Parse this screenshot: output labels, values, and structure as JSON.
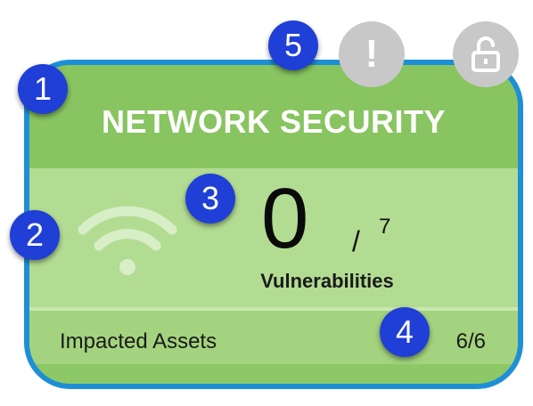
{
  "card": {
    "title": "NETWORK SECURITY",
    "icon": "wifi-icon",
    "vulnerabilities": {
      "count": "0",
      "separator": "/",
      "total": "7",
      "label": "Vulnerabilities"
    },
    "impacted_assets": {
      "label": "Impacted Assets",
      "value": "6/6"
    }
  },
  "status_buttons": {
    "alert": {
      "icon": "exclamation-icon",
      "glyph": "!"
    },
    "lock": {
      "icon": "unlock-icon"
    }
  },
  "callouts": [
    "1",
    "2",
    "3",
    "4",
    "5"
  ],
  "colors": {
    "card_border": "#1e8fd6",
    "card_header": "#88c460",
    "card_body": "#b2dc92",
    "card_footer": "#a3d37e",
    "callout": "#1f3fd6",
    "status_button": "#c8c8c8"
  }
}
